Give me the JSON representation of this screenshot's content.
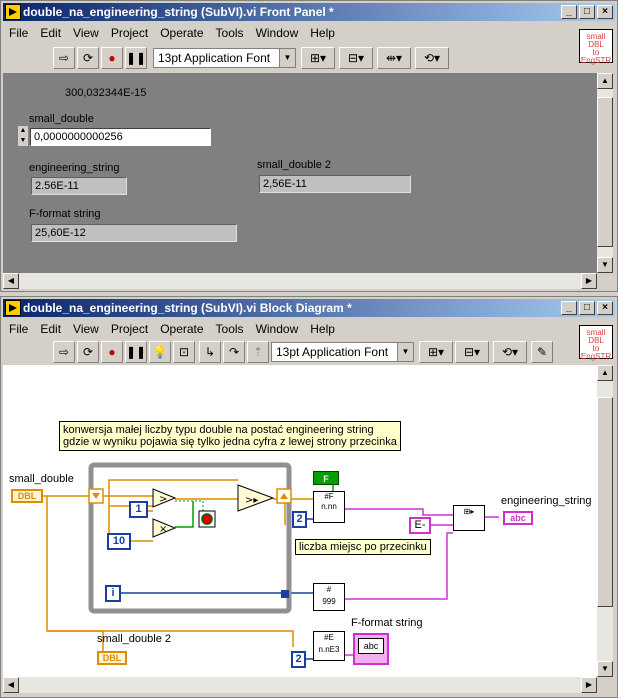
{
  "front_panel": {
    "title": "double_na_engineering_string (SubVI).vi Front Panel *",
    "menu": [
      "File",
      "Edit",
      "View",
      "Project",
      "Operate",
      "Tools",
      "Window",
      "Help"
    ],
    "font_select": "13pt Application Font",
    "icon_text": "small\nDBL\nto\nEngSTR",
    "free_label": "300,032344E-15",
    "small_double_label": "small_double",
    "small_double_value": "0,0000000000256",
    "engineering_string_label": "engineering_string",
    "engineering_string_value": "2.56E-11",
    "small_double2_label": "small_double 2",
    "small_double2_value": "2,56E-11",
    "fformat_label": "F-format string",
    "fformat_value": "25,60E-12"
  },
  "block_diagram": {
    "title": "double_na_engineering_string (SubVI).vi Block Diagram *",
    "menu": [
      "File",
      "Edit",
      "View",
      "Project",
      "Operate",
      "Tools",
      "Window",
      "Help"
    ],
    "font_select": "13pt Application Font",
    "comment_line1": "konwersja małej  liczby typu double na postać engineering string",
    "comment_line2": "gdzie w wyniku pojawia się tylko jedna cyfra z lewej strony przecinka",
    "small_double_label": "small_double",
    "small_double_terminal": "DBL",
    "engineering_string_label": "engineering_string",
    "engineering_string_terminal": "abc",
    "small_double2_label": "small_double 2",
    "small_double2_terminal": "DBL",
    "fformat_label": "F-format string",
    "fformat_terminal": "abc",
    "const_1": "1",
    "const_10": "10",
    "const_2a": "2",
    "const_2b": "2",
    "const_E": "E-",
    "bool_const": "F",
    "iteration_label": "i",
    "digits_label": "liczba miejsc po przecinku"
  },
  "colors": {
    "dbl_wire": "#e08c00",
    "string_wire": "#d030d0",
    "int_wire": "#1a3fa0",
    "titlebar": "#0a246a"
  }
}
